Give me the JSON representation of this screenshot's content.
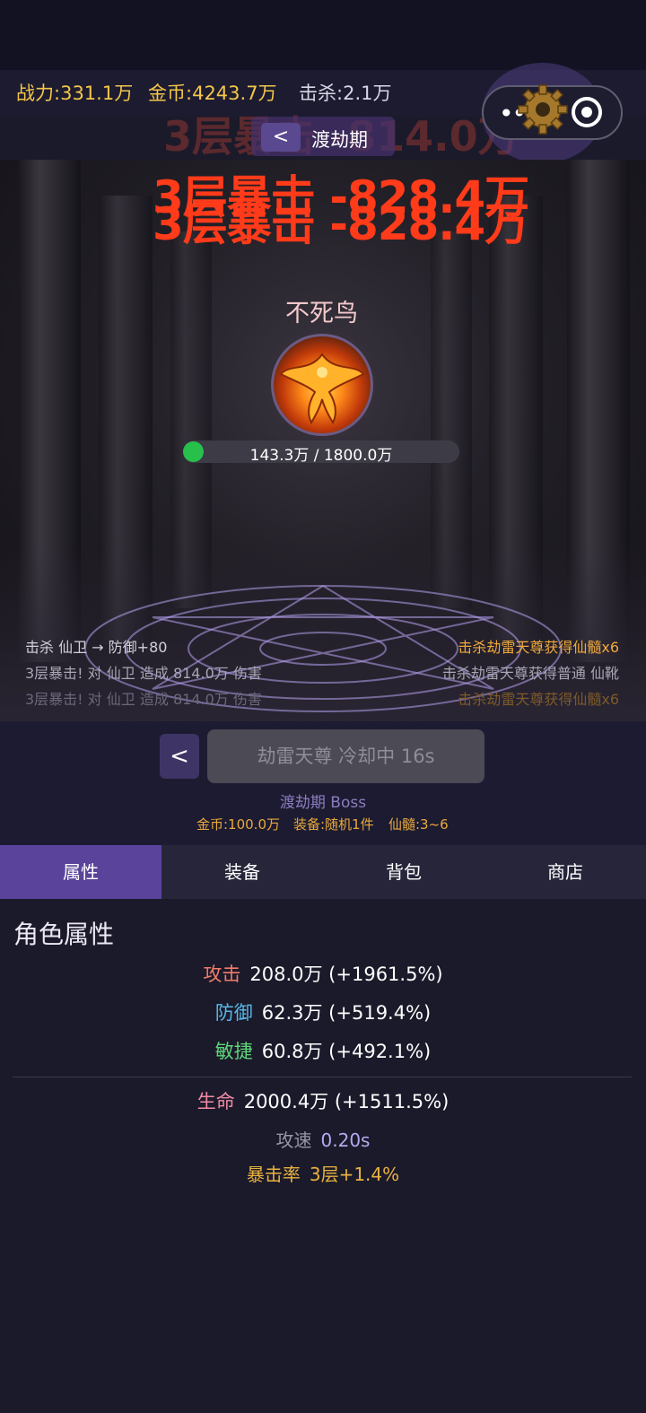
{
  "header": {
    "power": {
      "label": "战力:",
      "value": "331.1万"
    },
    "gold": {
      "label": "金币:",
      "value": "4243.7万"
    },
    "kills": {
      "label": "击杀:",
      "value": "2.1万"
    },
    "capsule_dots": "•••"
  },
  "floating": {
    "ghost_text": "3层暴击 -814.0万",
    "damage_1": "3层暴击 -828.4万",
    "damage_2": "3层暴击 -828.4万"
  },
  "stage": {
    "back_label": "<",
    "title": "渡劫期"
  },
  "boss": {
    "name": "不死鸟",
    "hp_text": "143.3万 / 1800.0万",
    "hp_fraction": 0.08
  },
  "battle_log": {
    "left": [
      "击杀 仙卫 → 防御+80",
      "3层暴击! 对 仙卫 造成 814.0万 伤害",
      "3层暴击! 对 仙卫 造成 814.0万 伤害"
    ],
    "right": [
      "击杀劫雷天尊获得仙髓x6",
      "击杀劫雷天尊获得普通 仙靴",
      "击杀劫雷天尊获得仙髓x6"
    ]
  },
  "boss_panel": {
    "prev_label": "<",
    "challenge_label": "劫雷天尊 冷却中 16s",
    "boss_label": "渡劫期 Boss",
    "rewards": {
      "gold": "金币:100.0万",
      "equip": "装备:随机1件",
      "marrow": "仙髓:3~6"
    }
  },
  "tabs": [
    {
      "label": "属性",
      "active": true
    },
    {
      "label": "装备",
      "active": false
    },
    {
      "label": "背包",
      "active": false
    },
    {
      "label": "商店",
      "active": false
    }
  ],
  "attributes": {
    "title": "角色属性",
    "attack": {
      "label": "攻击",
      "value": "208.0万 (+1961.5%)"
    },
    "defense": {
      "label": "防御",
      "value": "62.3万 (+519.4%)"
    },
    "agility": {
      "label": "敏捷",
      "value": "60.8万 (+492.1%)"
    },
    "hp": {
      "label": "生命",
      "value": "2000.4万 (+1511.5%)"
    },
    "speed": {
      "label": "攻速",
      "value": "0.20s"
    },
    "crit": {
      "label": "暴击率",
      "value": "3层+1.4%"
    }
  },
  "colors": {
    "accent_purple": "#5a449b",
    "gold_text": "#f4c64a",
    "damage_red": "#ff3b1a",
    "hp_green": "#27c04a"
  }
}
